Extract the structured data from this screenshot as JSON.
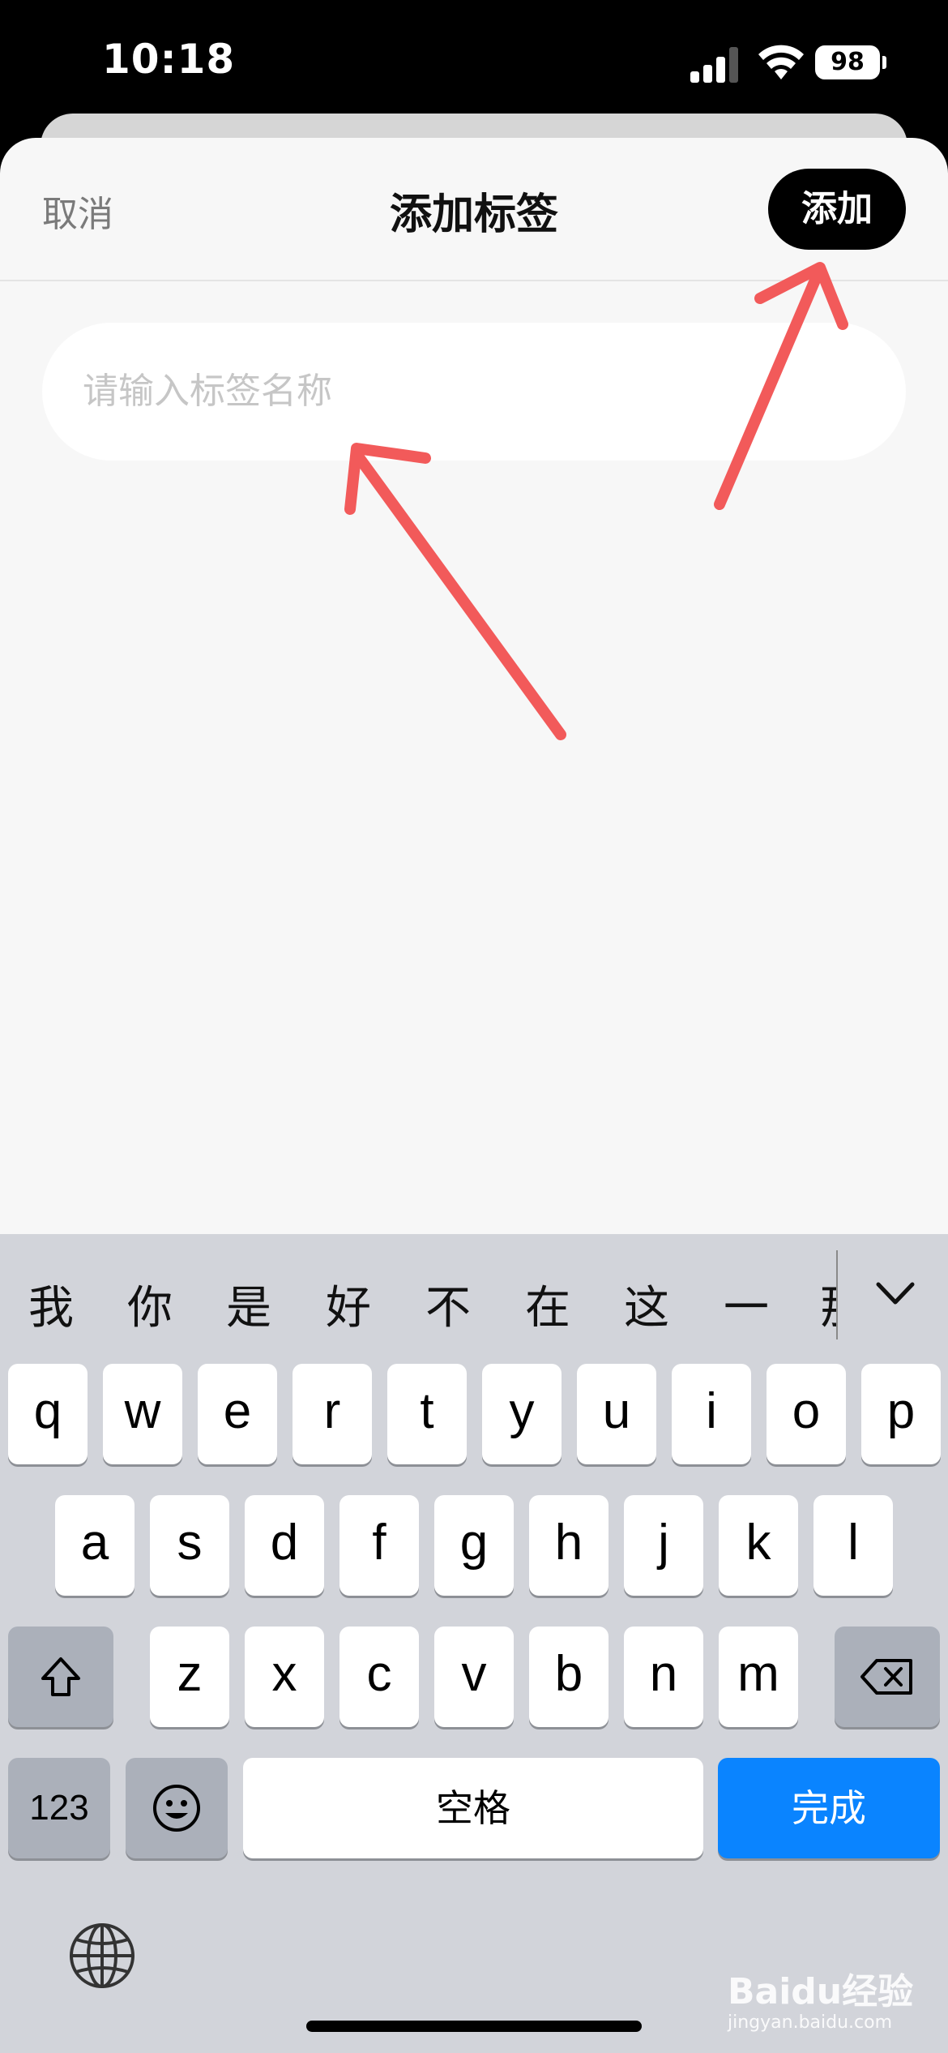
{
  "status": {
    "time": "10:18",
    "battery": "98"
  },
  "header": {
    "cancel": "取消",
    "title": "添加标签",
    "add": "添加"
  },
  "input": {
    "placeholder": "请输入标签名称",
    "value": ""
  },
  "candidates": [
    "我",
    "你",
    "是",
    "好",
    "不",
    "在",
    "这",
    "一",
    "那"
  ],
  "keyboard": {
    "row1": [
      "q",
      "w",
      "e",
      "r",
      "t",
      "y",
      "u",
      "i",
      "o",
      "p"
    ],
    "row2": [
      "a",
      "s",
      "d",
      "f",
      "g",
      "h",
      "j",
      "k",
      "l"
    ],
    "row3": [
      "z",
      "x",
      "c",
      "v",
      "b",
      "n",
      "m"
    ],
    "num": "123",
    "space": "空格",
    "done": "完成"
  },
  "watermark": {
    "main": "Baidu经验",
    "sub": "jingyan.baidu.com"
  },
  "colors": {
    "accent_done": "#0a84ff",
    "arrow": "#f25a5a"
  }
}
